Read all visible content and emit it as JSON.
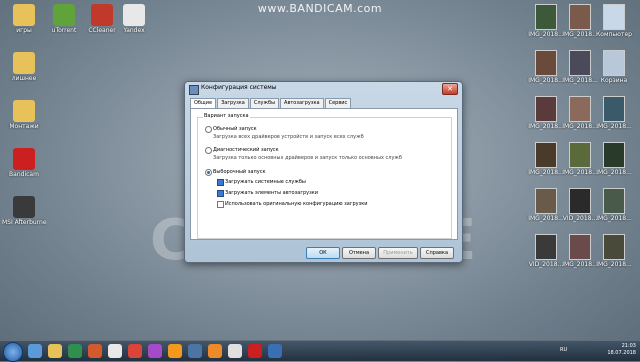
{
  "watermark": "www.BANDICAM.com",
  "desktop_left_icons": [
    {
      "label": "игры",
      "color": "#e7c15a"
    },
    {
      "label": "uTorrent",
      "color": "#5fa33a"
    },
    {
      "label": "CCleaner",
      "color": "#c0392b"
    },
    {
      "label": "Yandex",
      "color": "#e8e8e8"
    },
    {
      "label": "лишнее",
      "color": "#e7c15a"
    },
    {
      "label": "Монтажи",
      "color": "#e7c15a"
    },
    {
      "label": "Bandicam",
      "color": "#cc1f1f"
    },
    {
      "label": "MSI Afterburner",
      "color": "#3a3a3a"
    }
  ],
  "desktop_right_icons": [
    {
      "label": "IMG_2018...",
      "color": "#3c5a3a"
    },
    {
      "label": "IMG_2018...",
      "color": "#7a5a4a"
    },
    {
      "label": "Компьютер",
      "color": "#c8d8e8"
    },
    {
      "label": "IMG_2018...",
      "color": "#6a4a3a"
    },
    {
      "label": "IMG_2018...",
      "color": "#4a4a5a"
    },
    {
      "label": "Корзина",
      "color": "#b8c8d8"
    },
    {
      "label": "IMG_2018...",
      "color": "#5a3a3a"
    },
    {
      "label": "IMG_2018...",
      "color": "#8a6a5a"
    },
    {
      "label": "IMG_2018...",
      "color": "#3a5a6a"
    },
    {
      "label": "IMG_2018...",
      "color": "#4a3a2a"
    },
    {
      "label": "IMG_2018...",
      "color": "#5a6a3a"
    },
    {
      "label": "IMG_2018...",
      "color": "#2a3a2a"
    },
    {
      "label": "IMG_2018...",
      "color": "#6a5a4a"
    },
    {
      "label": "VID_2018...",
      "color": "#2a2a2a"
    },
    {
      "label": "IMG_2018...",
      "color": "#4a5a4a"
    },
    {
      "label": "VID_2018...",
      "color": "#3a3a3a"
    },
    {
      "label": "IMG_2018...",
      "color": "#6a4a4a"
    },
    {
      "label": "IMG_2018...",
      "color": "#4a4a3a"
    }
  ],
  "window": {
    "title": "Конфигурация системы",
    "close": "✕",
    "tabs": [
      "Общие",
      "Загрузка",
      "Службы",
      "Автозагрузка",
      "Сервис"
    ],
    "group_title": "Вариант запуска",
    "options": [
      {
        "label": "Обычный запуск",
        "sub": "Загрузка всех драйверов устройств и запуск всех служб",
        "selected": false
      },
      {
        "label": "Диагностический запуск",
        "sub": "Загрузка только основных драйверов и запуск только основных служб",
        "selected": false
      },
      {
        "label": "Выборочный запуск",
        "sub": "",
        "selected": true
      }
    ],
    "checkboxes": [
      {
        "label": "Загружать системные службы",
        "checked": true
      },
      {
        "label": "Загружать элементы автозагрузки",
        "checked": true
      },
      {
        "label": "Использовать оригинальную конфигурацию загрузки",
        "checked": false
      }
    ],
    "buttons": {
      "ok": "ОК",
      "cancel": "Отмена",
      "apply": "Применить",
      "help": "Справка"
    }
  },
  "taskbar": {
    "lang": "RU",
    "time": "21:03",
    "date": "18.07.2018"
  }
}
